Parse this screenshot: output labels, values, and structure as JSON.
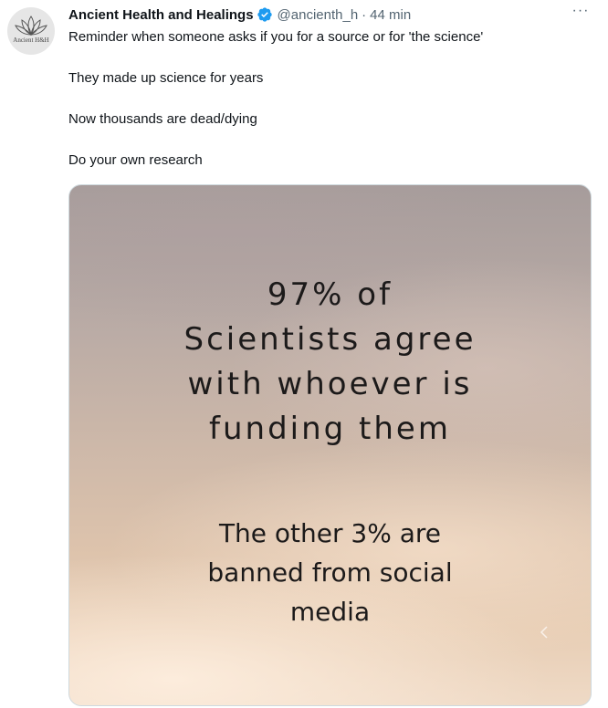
{
  "tweet": {
    "display_name": "Ancient Health and Healings",
    "handle": "@ancienth_h",
    "separator": "·",
    "time": "44 min",
    "more_label": "···",
    "avatar_text": "Ancient H&H",
    "verified_color": "#1d9bf0",
    "paragraphs": [
      "Reminder when someone asks if you for a source or for 'the science'",
      "They made up science for years",
      "Now thousands are dead/dying",
      "Do your own research"
    ],
    "media": {
      "headline_lines": [
        "97% of",
        "Scientists agree",
        "with whoever is",
        "funding them"
      ],
      "sub_lines": [
        "The other 3% are",
        "banned from social",
        "media"
      ]
    }
  }
}
